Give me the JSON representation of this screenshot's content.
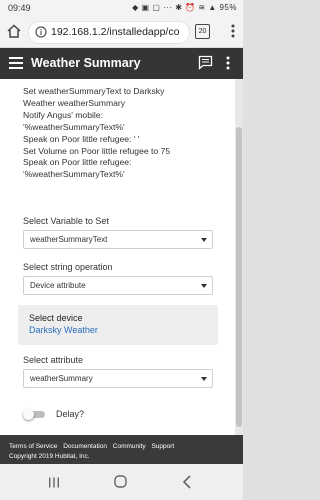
{
  "status_bar": {
    "time": "09:49",
    "icons_text": "◆ ▣ ▢ ··· ✱ ⏰ ≋ ▲ 95%"
  },
  "browser": {
    "url": "192.168.1.2/installedapp/co",
    "tab_count": "20"
  },
  "app_bar": {
    "title": "Weather Summary"
  },
  "description_lines": [
    "Set weatherSummaryText to Darksky",
    "Weather weatherSummary",
    "Notify Angus' mobile:",
    "'%weatherSummaryText%'",
    "Speak on Poor little refugee: ' '",
    "Set Volume on Poor little refugee to 75",
    "Speak on Poor little refugee:",
    "'%weatherSummaryText%'"
  ],
  "form": {
    "variable_label": "Select Variable to Set",
    "variable_value": "weatherSummaryText",
    "operation_label": "Select string operation",
    "operation_value": "Device attribute",
    "device_label": "Select device",
    "device_value": "Darksky Weather",
    "attribute_label": "Select attribute",
    "attribute_value": "weatherSummary",
    "delay_label": "Delay?",
    "delay_on": false
  },
  "footer": {
    "links": [
      "Terms of Service",
      "Documentation",
      "Community",
      "Support"
    ],
    "copyright": "Copyright 2019 Hubitat, Inc."
  },
  "colors": {
    "app_bar": "#353535",
    "footer": "#3a3a3a",
    "link": "#2a6ebb"
  },
  "icons": {
    "home": "home-icon",
    "lock": "lock-icon",
    "menu": "more-vert-icon",
    "hamburger": "hamburger-icon",
    "message": "message-icon"
  }
}
